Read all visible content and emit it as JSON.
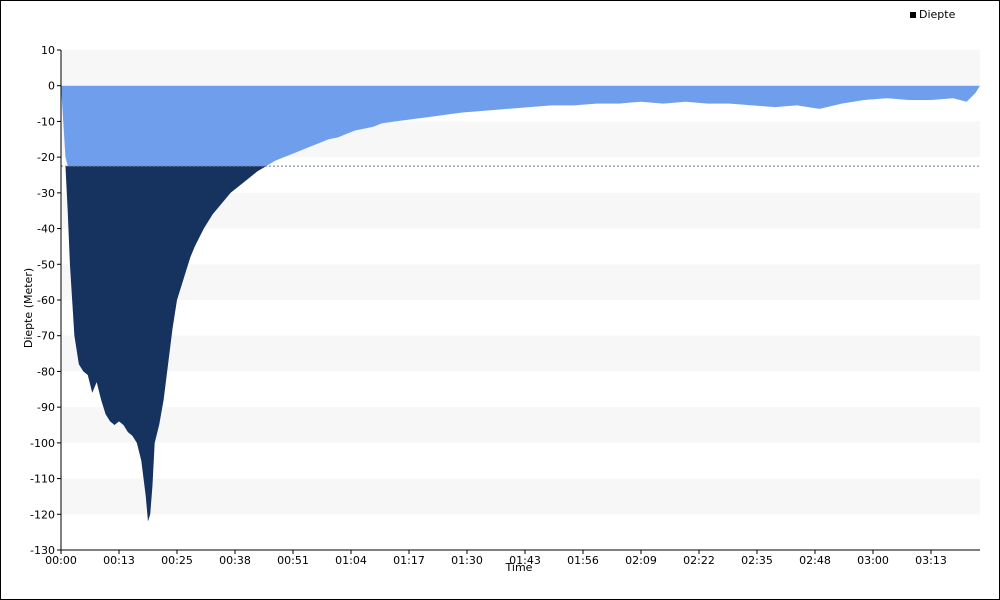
{
  "chart_data": {
    "type": "area",
    "title": "",
    "xlabel": "Time",
    "ylabel": "Diepte (Meter)",
    "legend": {
      "label": "Diepte",
      "placement": "top-right"
    },
    "ylim": [
      -130,
      10
    ],
    "yticks": [
      10,
      0,
      -10,
      -20,
      -30,
      -40,
      -50,
      -60,
      -70,
      -80,
      -90,
      -100,
      -110,
      -120,
      -130
    ],
    "xticks": [
      "00:00",
      "00:13",
      "00:25",
      "00:38",
      "00:51",
      "01:04",
      "01:17",
      "01:30",
      "01:43",
      "01:56",
      "02:09",
      "02:22",
      "02:35",
      "02:48",
      "03:00",
      "03:13"
    ],
    "x_unit": "minutes",
    "xlim": [
      0,
      206
    ],
    "threshold": -22.5,
    "grid": {
      "horizontal_bands": true
    },
    "colors": {
      "deep": "#16325e",
      "shallow": "#6f9fec",
      "band": "#f7f7f7",
      "threshold_line": "#6a7a9a"
    },
    "series": [
      {
        "name": "Diepte",
        "x": [
          0,
          0.5,
          1,
          1.5,
          2,
          3,
          4,
          5,
          6,
          7,
          8,
          9,
          10,
          11,
          12,
          13,
          14,
          15,
          16,
          17,
          18,
          19,
          19.5,
          20,
          20.5,
          21,
          22,
          23,
          24,
          25,
          26,
          27,
          28,
          29,
          30,
          32,
          34,
          36,
          38,
          40,
          42,
          44,
          46,
          48,
          50,
          52,
          54,
          56,
          58,
          60,
          62,
          64,
          66,
          68,
          70,
          72,
          75,
          78,
          81,
          84,
          87,
          90,
          95,
          100,
          105,
          110,
          115,
          120,
          125,
          130,
          135,
          140,
          145,
          150,
          155,
          160,
          165,
          170,
          175,
          180,
          185,
          190,
          195,
          200,
          203,
          205,
          206
        ],
        "values": [
          0,
          -10,
          -20,
          -35,
          -50,
          -70,
          -78,
          -80,
          -81,
          -86,
          -83,
          -88,
          -92,
          -94,
          -95,
          -94,
          -95,
          -97,
          -98,
          -100,
          -105,
          -115,
          -122,
          -120,
          -112,
          -100,
          -95,
          -88,
          -78,
          -68,
          -60,
          -56,
          -52,
          -48,
          -45,
          -40,
          -36,
          -33,
          -30,
          -28,
          -26,
          -24,
          -22.5,
          -21,
          -20,
          -19,
          -18,
          -17,
          -16,
          -15,
          -14.5,
          -13.5,
          -12.5,
          -12,
          -11.5,
          -10.5,
          -10,
          -9.5,
          -9,
          -8.5,
          -8,
          -7.5,
          -7,
          -6.5,
          -6,
          -5.5,
          -5.5,
          -5,
          -5,
          -4.5,
          -5,
          -4.5,
          -5,
          -5,
          -5.5,
          -6,
          -5.5,
          -6.5,
          -5,
          -4,
          -3.5,
          -4,
          -4,
          -3.5,
          -4.5,
          -2,
          0
        ]
      }
    ]
  }
}
